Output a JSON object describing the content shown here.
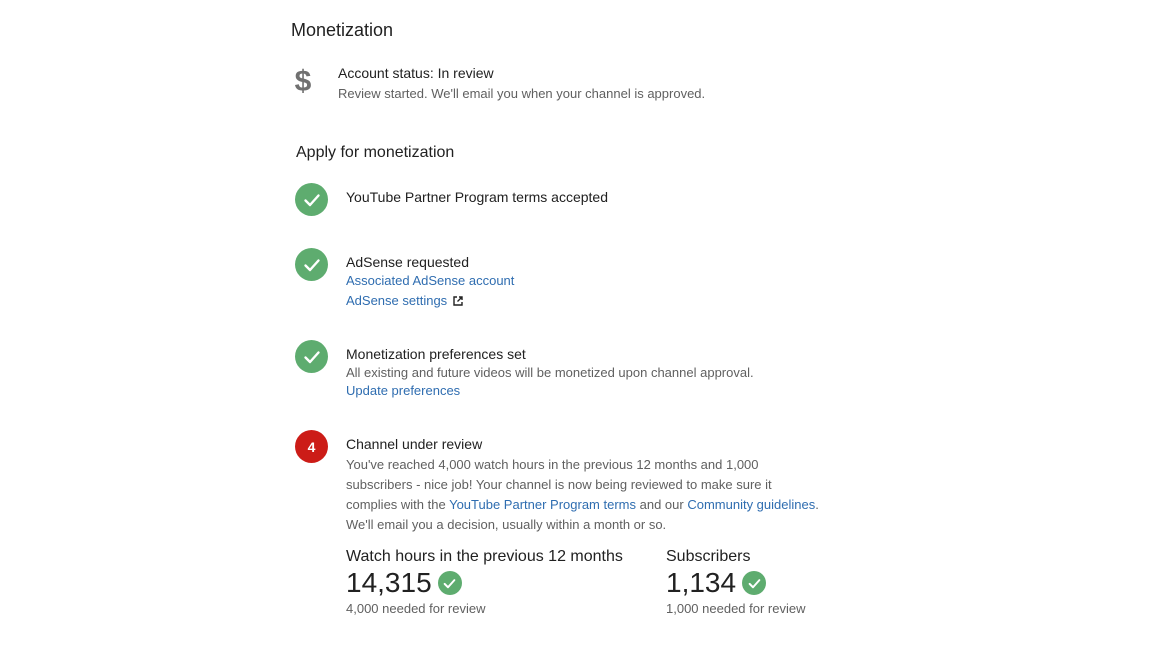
{
  "page": {
    "title": "Monetization"
  },
  "account_status": {
    "title": "Account status: In review",
    "subtitle": "Review started. We'll email you when your channel is approved.",
    "icon": "dollar-icon"
  },
  "apply": {
    "title": "Apply for monetization",
    "steps": [
      {
        "status": "done",
        "title": "YouTube Partner Program terms accepted"
      },
      {
        "status": "done",
        "title": "AdSense requested",
        "links": [
          "Associated AdSense account",
          "AdSense settings"
        ]
      },
      {
        "status": "done",
        "title": "Monetization preferences set",
        "text": "All existing and future videos will be monetized upon channel approval.",
        "links": [
          "Update preferences"
        ]
      },
      {
        "status": "current",
        "number": "4",
        "title": "Channel under review",
        "para": {
          "line1": "You've reached 4,000 watch hours in the previous 12 months and 1,000",
          "line2": "subscribers - nice job! Your channel is now being reviewed to make sure it",
          "line3_prefix": "complies with the ",
          "line3_link1": "YouTube Partner Program terms",
          "line3_mid": " and our ",
          "line3_link2": "Community guidelines",
          "line3_suffix": ".",
          "line4": "We'll email you a decision, usually within a month or so."
        },
        "stats": [
          {
            "label": "Watch hours in the previous 12 months",
            "value": "14,315",
            "note": "4,000 needed for review"
          },
          {
            "label": "Subscribers",
            "value": "1,134",
            "note": "1,000 needed for review"
          }
        ]
      }
    ]
  },
  "colors": {
    "success": "#5eac6f",
    "alert": "#cc1c17",
    "link": "#2f6db0",
    "text": "#212121",
    "secondary_text": "#606060"
  }
}
